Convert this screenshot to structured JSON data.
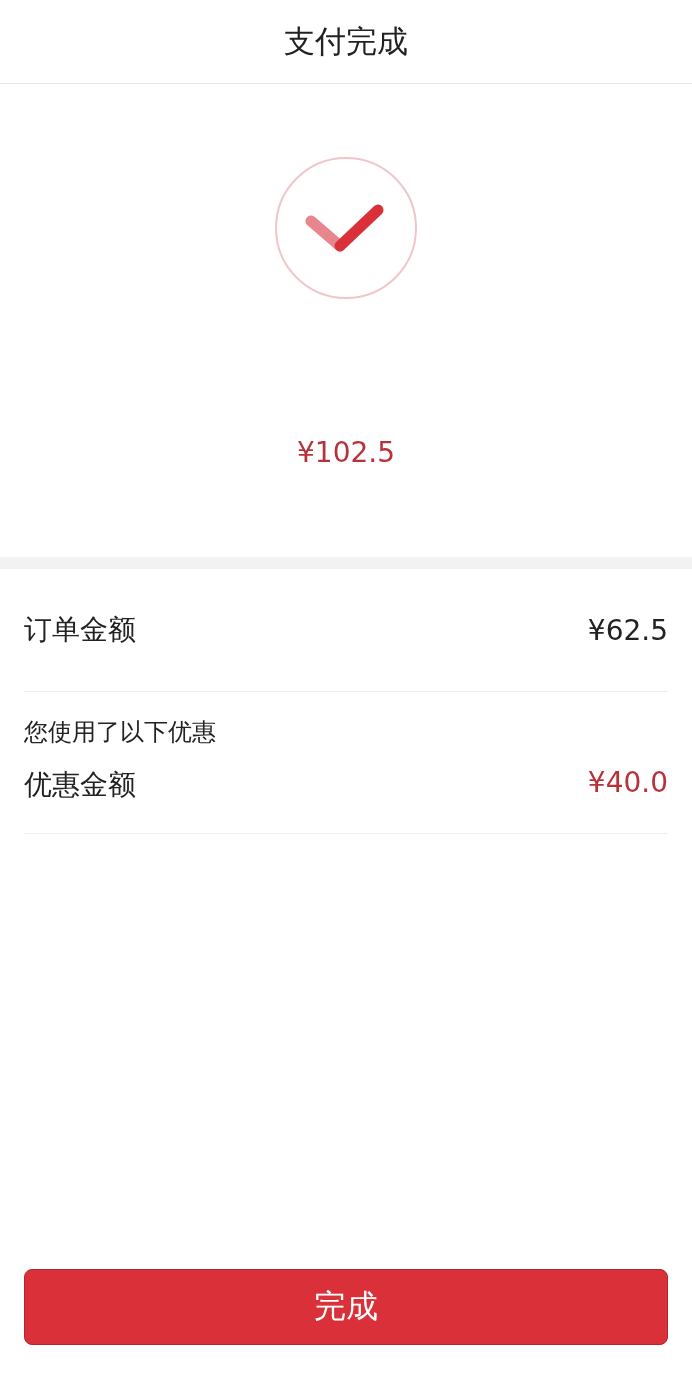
{
  "header": {
    "title": "支付完成"
  },
  "result": {
    "amount": "¥102.5"
  },
  "order": {
    "label": "订单金额",
    "value": "¥62.5",
    "highlight": false
  },
  "discount_note": "您使用了以下优惠",
  "discount": {
    "label": "优惠金额",
    "value": "¥40.0",
    "highlight": true
  },
  "buttons": [
    {
      "label": "完成"
    }
  ]
}
